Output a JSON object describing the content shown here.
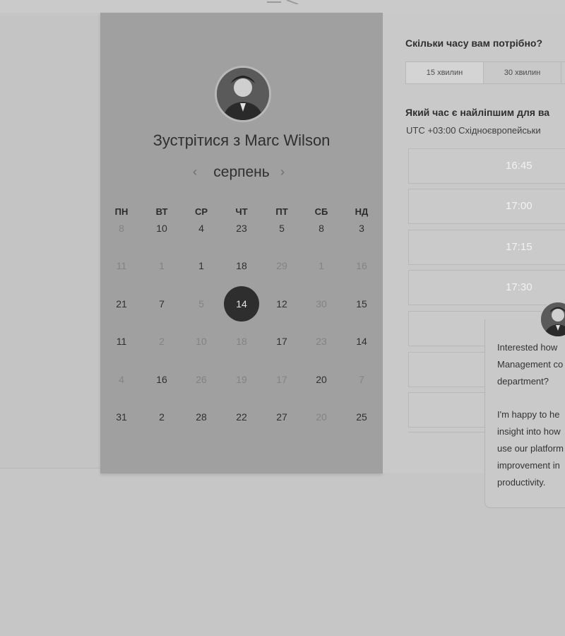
{
  "meeting": {
    "title": "Зустрітися з Marc Wilson",
    "month": "серпень",
    "prev_icon": "‹",
    "next_icon": "›"
  },
  "calendar": {
    "weekdays": [
      "ПН",
      "ВТ",
      "СР",
      "ЧТ",
      "ПТ",
      "СБ",
      "НД"
    ],
    "selected_day": "14",
    "weeks": [
      [
        {
          "d": "8",
          "a": false
        },
        {
          "d": "10",
          "a": true
        },
        {
          "d": "4",
          "a": true
        },
        {
          "d": "23",
          "a": true
        },
        {
          "d": "5",
          "a": true
        },
        {
          "d": "8",
          "a": true
        },
        {
          "d": "3",
          "a": true
        }
      ],
      [
        {
          "d": "11",
          "a": false
        },
        {
          "d": "1",
          "a": false
        },
        {
          "d": "1",
          "a": true
        },
        {
          "d": "18",
          "a": true
        },
        {
          "d": "29",
          "a": false
        },
        {
          "d": "1",
          "a": false
        },
        {
          "d": "16",
          "a": false
        }
      ],
      [
        {
          "d": "21",
          "a": true
        },
        {
          "d": "7",
          "a": true
        },
        {
          "d": "5",
          "a": false
        },
        {
          "d": "14",
          "a": true,
          "sel": true
        },
        {
          "d": "12",
          "a": true
        },
        {
          "d": "30",
          "a": false
        },
        {
          "d": "15",
          "a": true
        }
      ],
      [
        {
          "d": "11",
          "a": true
        },
        {
          "d": "2",
          "a": false
        },
        {
          "d": "10",
          "a": false
        },
        {
          "d": "18",
          "a": false
        },
        {
          "d": "17",
          "a": true
        },
        {
          "d": "23",
          "a": false
        },
        {
          "d": "14",
          "a": true
        }
      ],
      [
        {
          "d": "4",
          "a": false
        },
        {
          "d": "16",
          "a": true
        },
        {
          "d": "26",
          "a": false
        },
        {
          "d": "19",
          "a": false
        },
        {
          "d": "17",
          "a": false
        },
        {
          "d": "20",
          "a": true
        },
        {
          "d": "7",
          "a": false
        }
      ],
      [
        {
          "d": "31",
          "a": true
        },
        {
          "d": "2",
          "a": true
        },
        {
          "d": "28",
          "a": true
        },
        {
          "d": "22",
          "a": true
        },
        {
          "d": "27",
          "a": true
        },
        {
          "d": "20",
          "a": false
        },
        {
          "d": "25",
          "a": true
        }
      ]
    ]
  },
  "duration": {
    "question": "Скільки часу вам потрібно?",
    "options": [
      "15 хвилин",
      "30 хвилин"
    ],
    "selected": "15 хвилин"
  },
  "time": {
    "question": "Який час є найліпшим для ва",
    "timezone": "UTC +03:00 Східноєвропейськи",
    "slots": [
      "16:45",
      "17:00",
      "17:15",
      "17:30",
      "",
      "",
      ""
    ]
  },
  "chat": {
    "lines": [
      "Interested how",
      "Management co",
      "department?",
      "",
      "I'm happy to he",
      "insight into how",
      "use our platform",
      "improvement in",
      "productivity."
    ]
  },
  "icons": {
    "avatar": "person-avatar-icon",
    "chat_avatar": "person-avatar-icon"
  },
  "colors": {
    "selected_day_bg": "#2e2e2e",
    "calendar_panel_bg": "#a0a0a0"
  }
}
